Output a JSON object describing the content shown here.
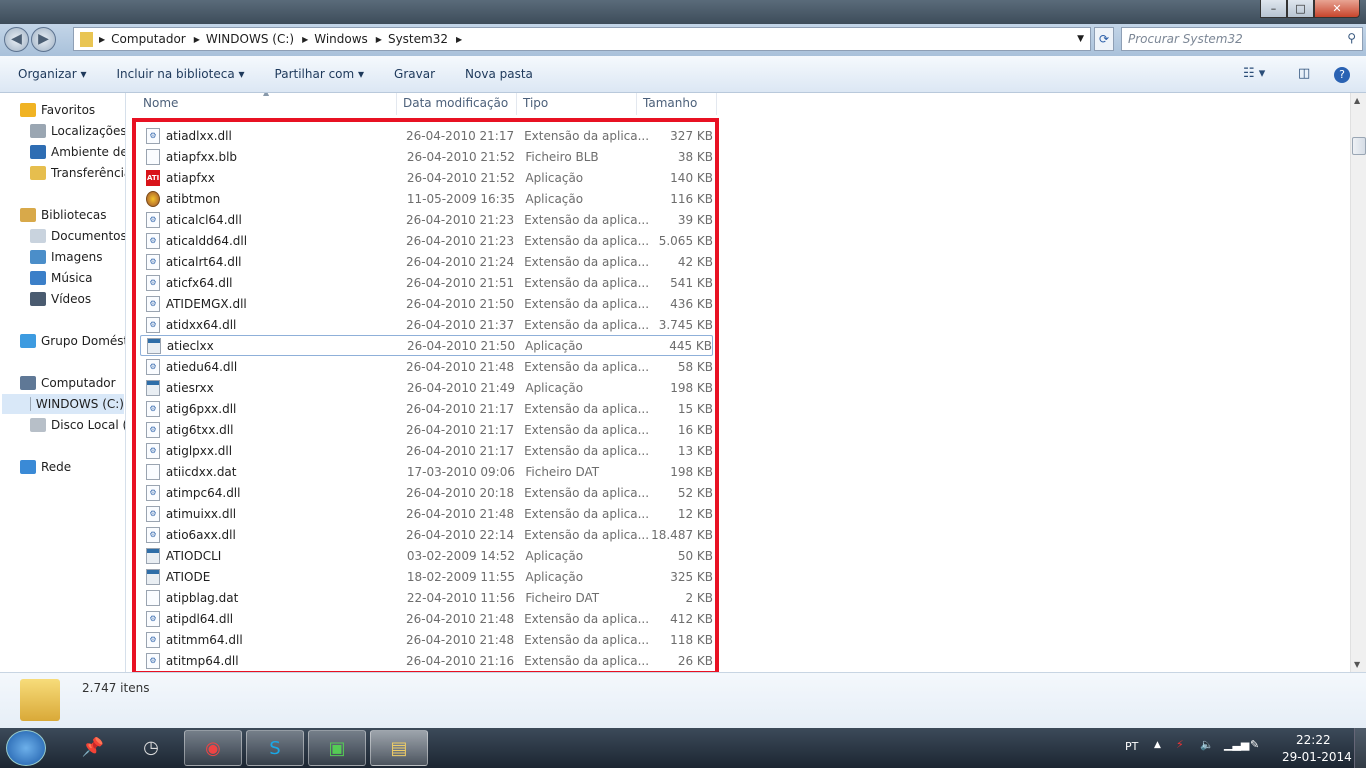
{
  "window": {
    "minimize": "–",
    "maximize": "□",
    "close": "✕"
  },
  "address": {
    "crumbs": [
      "Computador",
      "WINDOWS (C:)",
      "Windows",
      "System32"
    ],
    "search_placeholder": "Procurar System32"
  },
  "toolbar": {
    "items": [
      "Organizar ▾",
      "Incluir na biblioteca ▾",
      "Partilhar com ▾",
      "Gravar",
      "Nova pasta"
    ]
  },
  "nav": {
    "items": [
      {
        "label": "Favoritos",
        "icon": "star-icon",
        "color": "#f0b323"
      },
      {
        "label": "Localizações",
        "icon": "recent-places-icon",
        "color": "#9aa6b2"
      },
      {
        "label": "Ambiente de trabalho",
        "icon": "desktop-icon",
        "color": "#2e6db3"
      },
      {
        "label": "Transferências",
        "icon": "downloads-folder-icon",
        "color": "#e6be4e"
      },
      {
        "label": "Bibliotecas",
        "icon": "libraries-icon",
        "color": "#d8a94a"
      },
      {
        "label": "Documentos",
        "icon": "documents-icon",
        "color": "#c9d3de"
      },
      {
        "label": "Imagens",
        "icon": "pictures-icon",
        "color": "#4b8ec9"
      },
      {
        "label": "Música",
        "icon": "music-icon",
        "color": "#3b7fc8"
      },
      {
        "label": "Vídeos",
        "icon": "videos-icon",
        "color": "#4a5b70"
      },
      {
        "label": "Grupo Doméstico",
        "icon": "homegroup-icon",
        "color": "#3d9be0"
      },
      {
        "label": "Computador",
        "icon": "computer-icon",
        "color": "#5f7896"
      },
      {
        "label": "WINDOWS (C:)",
        "icon": "drive-icon",
        "color": "#9aa7b5"
      },
      {
        "label": "Disco Local (D:)",
        "icon": "drive-icon",
        "color": "#b7bfc8"
      },
      {
        "label": "Rede",
        "icon": "network-icon",
        "color": "#3a8ad6"
      }
    ]
  },
  "columns": [
    "Nome",
    "Data modificação",
    "Tipo",
    "Tamanho"
  ],
  "files": [
    [
      "atiadlxx.dll",
      "26-04-2010 21:17",
      "Extensão da aplica...",
      "327 KB",
      "dll"
    ],
    [
      "atiapfxx.blb",
      "26-04-2010 21:52",
      "Ficheiro BLB",
      "38 KB",
      "file"
    ],
    [
      "atiapfxx",
      "26-04-2010 21:52",
      "Aplicação",
      "140 KB",
      "ati"
    ],
    [
      "atibtmon",
      "11-05-2009 16:35",
      "Aplicação",
      "116 KB",
      "mon"
    ],
    [
      "aticalcl64.dll",
      "26-04-2010 21:23",
      "Extensão da aplica...",
      "39 KB",
      "dll"
    ],
    [
      "aticaldd64.dll",
      "26-04-2010 21:23",
      "Extensão da aplica...",
      "5.065 KB",
      "dll"
    ],
    [
      "aticalrt64.dll",
      "26-04-2010 21:24",
      "Extensão da aplica...",
      "42 KB",
      "dll"
    ],
    [
      "aticfx64.dll",
      "26-04-2010 21:51",
      "Extensão da aplica...",
      "541 KB",
      "dll"
    ],
    [
      "ATIDEMGX.dll",
      "26-04-2010 21:50",
      "Extensão da aplica...",
      "436 KB",
      "dll"
    ],
    [
      "atidxx64.dll",
      "26-04-2010 21:37",
      "Extensão da aplica...",
      "3.745 KB",
      "dll"
    ],
    [
      "atieclxx",
      "26-04-2010 21:50",
      "Aplicação",
      "445 KB",
      "exe"
    ],
    [
      "atiedu64.dll",
      "26-04-2010 21:48",
      "Extensão da aplica...",
      "58 KB",
      "dll"
    ],
    [
      "atiesrxx",
      "26-04-2010 21:49",
      "Aplicação",
      "198 KB",
      "exe"
    ],
    [
      "atig6pxx.dll",
      "26-04-2010 21:17",
      "Extensão da aplica...",
      "15 KB",
      "dll"
    ],
    [
      "atig6txx.dll",
      "26-04-2010 21:17",
      "Extensão da aplica...",
      "16 KB",
      "dll"
    ],
    [
      "atiglpxx.dll",
      "26-04-2010 21:17",
      "Extensão da aplica...",
      "13 KB",
      "dll"
    ],
    [
      "atiicdxx.dat",
      "17-03-2010 09:06",
      "Ficheiro DAT",
      "198 KB",
      "file"
    ],
    [
      "atimpc64.dll",
      "26-04-2010 20:18",
      "Extensão da aplica...",
      "52 KB",
      "dll"
    ],
    [
      "atimuixx.dll",
      "26-04-2010 21:48",
      "Extensão da aplica...",
      "12 KB",
      "dll"
    ],
    [
      "atio6axx.dll",
      "26-04-2010 22:14",
      "Extensão da aplica...",
      "18.487 KB",
      "dll"
    ],
    [
      "ATIODCLI",
      "03-02-2009 14:52",
      "Aplicação",
      "50 KB",
      "exe"
    ],
    [
      "ATIODE",
      "18-02-2009 11:55",
      "Aplicação",
      "325 KB",
      "exe"
    ],
    [
      "atipblag.dat",
      "22-04-2010 11:56",
      "Ficheiro DAT",
      "2 KB",
      "file"
    ],
    [
      "atipdl64.dll",
      "26-04-2010 21:48",
      "Extensão da aplica...",
      "412 KB",
      "dll"
    ],
    [
      "atitmm64.dll",
      "26-04-2010 21:48",
      "Extensão da aplica...",
      "118 KB",
      "dll"
    ],
    [
      "atitmp64.dll",
      "26-04-2010 21:16",
      "Extensão da aplica...",
      "26 KB",
      "dll"
    ]
  ],
  "status": {
    "count": "2.747 itens"
  },
  "tray": {
    "lang": "PT",
    "time": "22:22",
    "date": "29-01-2014"
  }
}
